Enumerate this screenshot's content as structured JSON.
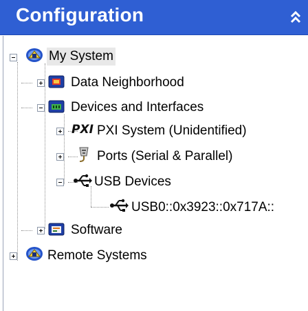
{
  "header": {
    "title": "Configuration",
    "collapse_icon": "double-chevron-up-icon",
    "background": "#2f5fd3"
  },
  "tree": {
    "my_system": {
      "label": "My System",
      "icon": "ni-system-icon",
      "expanded": true,
      "selected": true
    },
    "data_neighborhood": {
      "label": "Data Neighborhood",
      "icon": "data-neighborhood-icon",
      "expanded": false
    },
    "devices_interfaces": {
      "label": "Devices and Interfaces",
      "icon": "devices-interfaces-icon",
      "expanded": true
    },
    "pxi_system": {
      "label": "PXI System (Unidentified)",
      "icon_text": "PXI",
      "icon": "pxi-icon",
      "expanded": false
    },
    "ports": {
      "label": "Ports (Serial & Parallel)",
      "icon": "port-connector-icon",
      "expanded": false
    },
    "usb_devices": {
      "label": "USB Devices",
      "icon": "usb-icon",
      "expanded": true
    },
    "usb_device": {
      "label": "USB0::0x3923::0x717A::",
      "icon": "usb-icon"
    },
    "software": {
      "label": "Software",
      "icon": "software-icon",
      "expanded": false
    },
    "remote_systems": {
      "label": "Remote Systems",
      "icon": "ni-system-icon",
      "expanded": false
    }
  }
}
